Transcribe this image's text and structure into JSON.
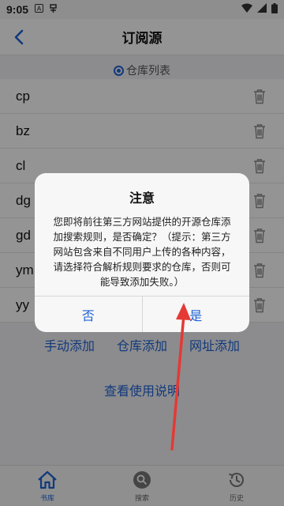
{
  "status_bar": {
    "time": "9:05",
    "icons": [
      "a-icon",
      "notification-icon",
      "wifi-icon",
      "signal-icon",
      "battery-icon"
    ]
  },
  "header": {
    "title": "订阅源",
    "back_icon": "chevron-left-icon"
  },
  "source_toggle": {
    "label": "仓库列表"
  },
  "sources": [
    {
      "name": "cp"
    },
    {
      "name": "bz"
    },
    {
      "name": "cl"
    },
    {
      "name": "dg"
    },
    {
      "name": "gd"
    },
    {
      "name": "ym"
    },
    {
      "name": "yy"
    }
  ],
  "actions": {
    "manual_add": "手动添加",
    "repo_add": "仓库添加",
    "url_add": "网址添加",
    "help": "查看使用说明"
  },
  "dialog": {
    "title": "注意",
    "message": "您即将前往第三方网站提供的开源仓库添加搜索规则，是否确定？（提示：第三方网站包含来自不同用户上传的各种内容，请选择符合解析规则要求的仓库，否则可能导致添加失败。）",
    "cancel_label": "否",
    "confirm_label": "是"
  },
  "bottom_nav": [
    {
      "label": "书库",
      "icon": "home-icon",
      "active": true
    },
    {
      "label": "搜索",
      "icon": "search-icon",
      "active": false
    },
    {
      "label": "历史",
      "icon": "history-icon",
      "active": false
    }
  ],
  "colors": {
    "accent": "#1e63d6",
    "arrow": "#e53935"
  }
}
